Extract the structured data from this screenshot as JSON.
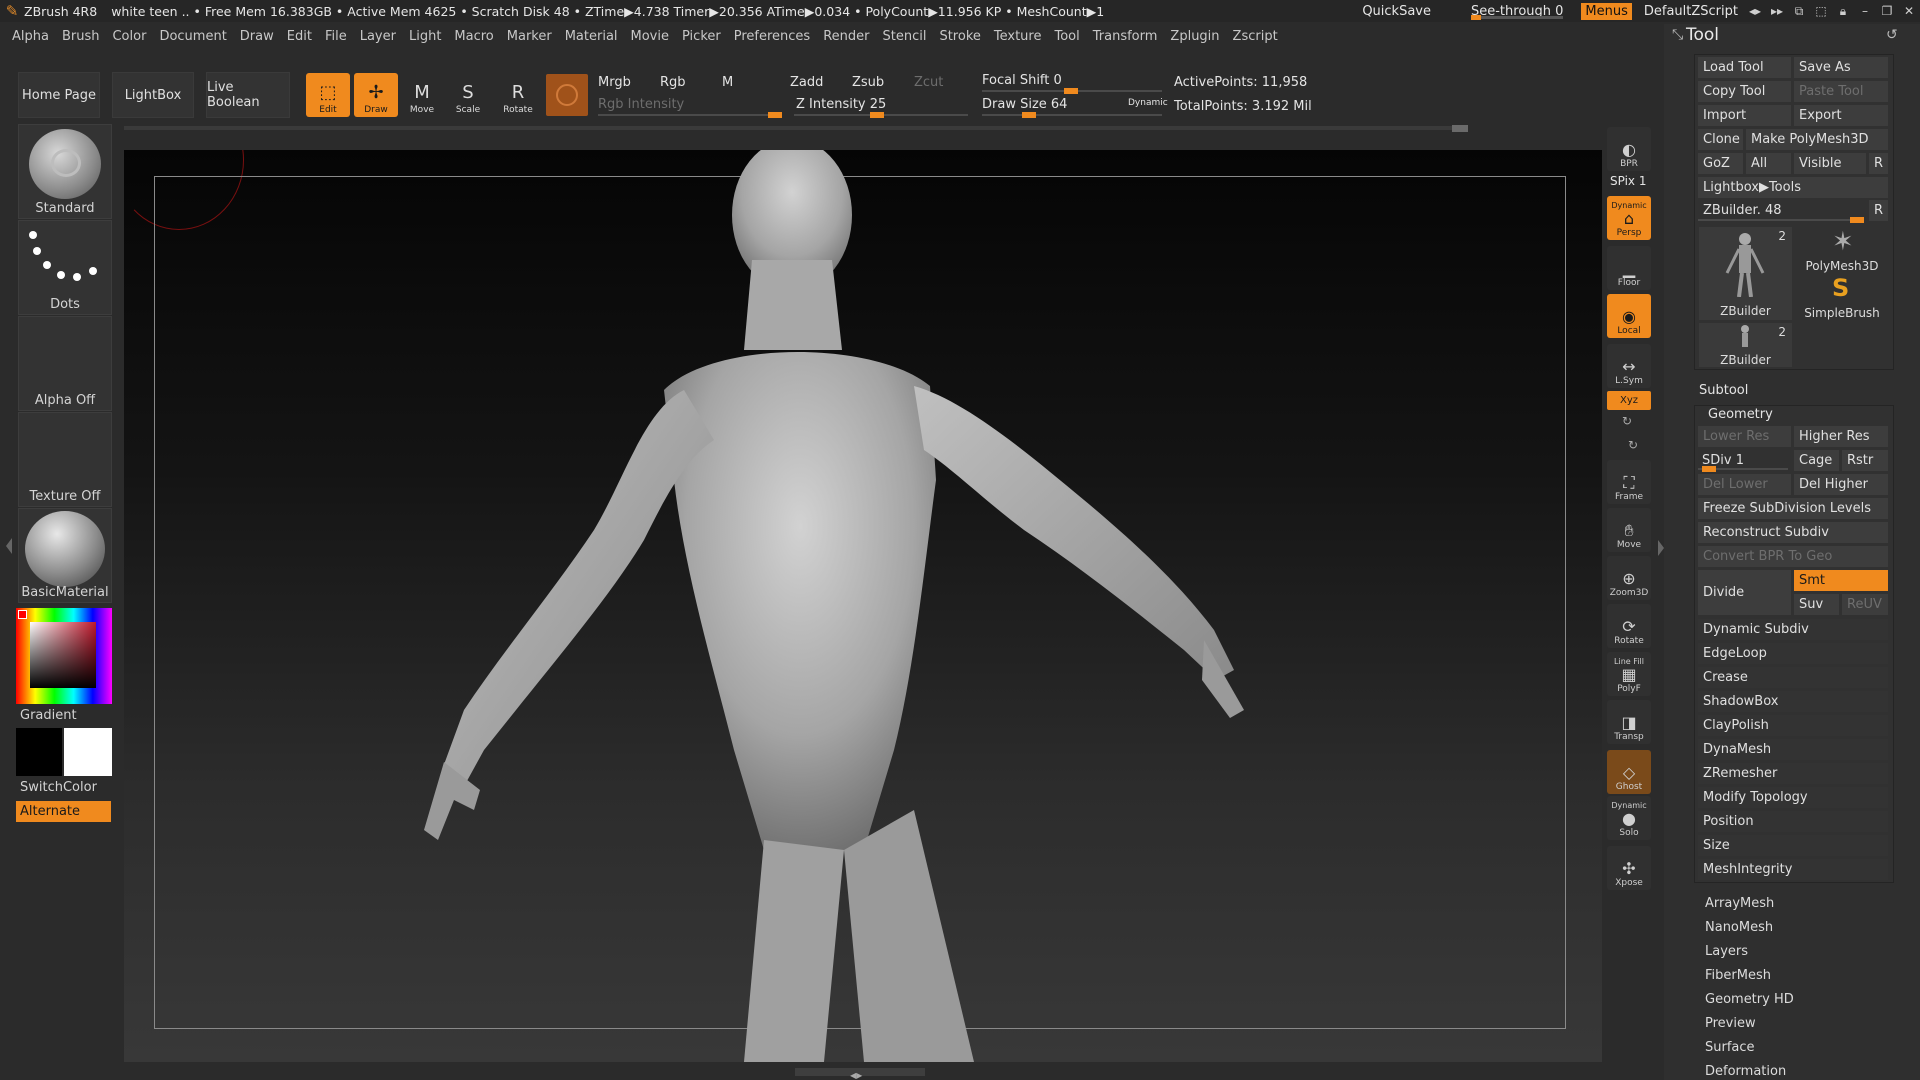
{
  "titlebar": {
    "app": "ZBrush 4R8",
    "status": "white teen  .. • Free Mem 16.383GB • Active Mem 4625 • Scratch Disk 48 • ZTime▶4.738 Timer▶20.356 ATime▶0.034 • PolyCount▶11.956 KP  • MeshCount▶1",
    "quicksave": "QuickSave",
    "see_through": "See-through  0",
    "menus": "Menus",
    "script": "DefaultZScript"
  },
  "menubar": [
    "Alpha",
    "Brush",
    "Color",
    "Document",
    "Draw",
    "Edit",
    "File",
    "Layer",
    "Light",
    "Macro",
    "Marker",
    "Material",
    "Movie",
    "Picker",
    "Preferences",
    "Render",
    "Stencil",
    "Stroke",
    "Texture",
    "Tool",
    "Transform",
    "Zplugin",
    "Zscript"
  ],
  "shelf": {
    "home_page": "Home Page",
    "lightbox": "LightBox",
    "live_boolean": "Live Boolean",
    "edit": "Edit",
    "draw": "Draw",
    "move": "Move",
    "scale": "Scale",
    "rotate": "Rotate",
    "mrgb": "Mrgb",
    "rgb": "Rgb",
    "m": "M",
    "rgb_intensity": "Rgb Intensity",
    "zadd": "Zadd",
    "zsub": "Zsub",
    "zcut": "Zcut",
    "z_intensity": "Z Intensity 25",
    "focal_shift": "Focal Shift 0",
    "draw_size": "Draw Size 64",
    "dynamic": "Dynamic",
    "active_points": "ActivePoints: 11,958",
    "total_points": "TotalPoints: 3.192 Mil"
  },
  "left": {
    "brush": "Standard",
    "stroke": "Dots",
    "alpha": "Alpha Off",
    "texture": "Texture Off",
    "material": "BasicMaterial",
    "gradient": "Gradient",
    "switch_color": "SwitchColor",
    "alternate": "Alternate"
  },
  "right_strip": {
    "bpr": "BPR",
    "spix": "SPix 1",
    "dynamic": "Dynamic",
    "persp": "Persp",
    "floor": "Floor",
    "local": "Local",
    "lsym": "L.Sym",
    "xyz": "Xyz",
    "frame": "Frame",
    "move": "Move",
    "zoom3d": "Zoom3D",
    "rotate": "Rotate",
    "line_fill": "Line Fill",
    "polyf": "PolyF",
    "transp": "Transp",
    "ghost": "Ghost",
    "dynamic2": "Dynamic",
    "solo": "Solo",
    "xpose": "Xpose"
  },
  "tool": {
    "title": "Tool",
    "load_tool": "Load Tool",
    "save_as": "Save As",
    "copy_tool": "Copy Tool",
    "paste_tool": "Paste Tool",
    "import": "Import",
    "export": "Export",
    "clone": "Clone",
    "make_polymesh": "Make PolyMesh3D",
    "goz": "GoZ",
    "all": "All",
    "visible": "Visible",
    "r": "R",
    "lightbox_tools": "Lightbox▶Tools",
    "zbuilder_slider": "ZBuilder. 48",
    "thumb1": "ZBuilder",
    "thumb1_count": "2",
    "thumb2": "PolyMesh3D",
    "thumb3": "SimpleBrush",
    "thumb4": "ZBuilder",
    "thumb4_count": "2",
    "subtool": "Subtool",
    "geometry": "Geometry",
    "lower_res": "Lower Res",
    "higher_res": "Higher Res",
    "sdiv": "SDiv 1",
    "cage": "Cage",
    "rstr": "Rstr",
    "del_lower": "Del Lower",
    "del_higher": "Del Higher",
    "freeze": "Freeze SubDivision Levels",
    "reconstruct": "Reconstruct Subdiv",
    "convert_bpr": "Convert BPR To Geo",
    "divide": "Divide",
    "smt": "Smt",
    "suv": "Suv",
    "reuv": "ReUV",
    "geo_items": [
      "Dynamic Subdiv",
      "EdgeLoop",
      "Crease",
      "ShadowBox",
      "ClayPolish",
      "DynaMesh",
      "ZRemesher",
      "Modify Topology",
      "Position",
      "Size",
      "MeshIntegrity"
    ],
    "sections": [
      "ArrayMesh",
      "NanoMesh",
      "Layers",
      "FiberMesh",
      "Geometry HD",
      "Preview",
      "Surface",
      "Deformation"
    ]
  },
  "colors": {
    "accent": "#f08a1e",
    "bg": "#2b2b2b",
    "panel": "#333333"
  }
}
